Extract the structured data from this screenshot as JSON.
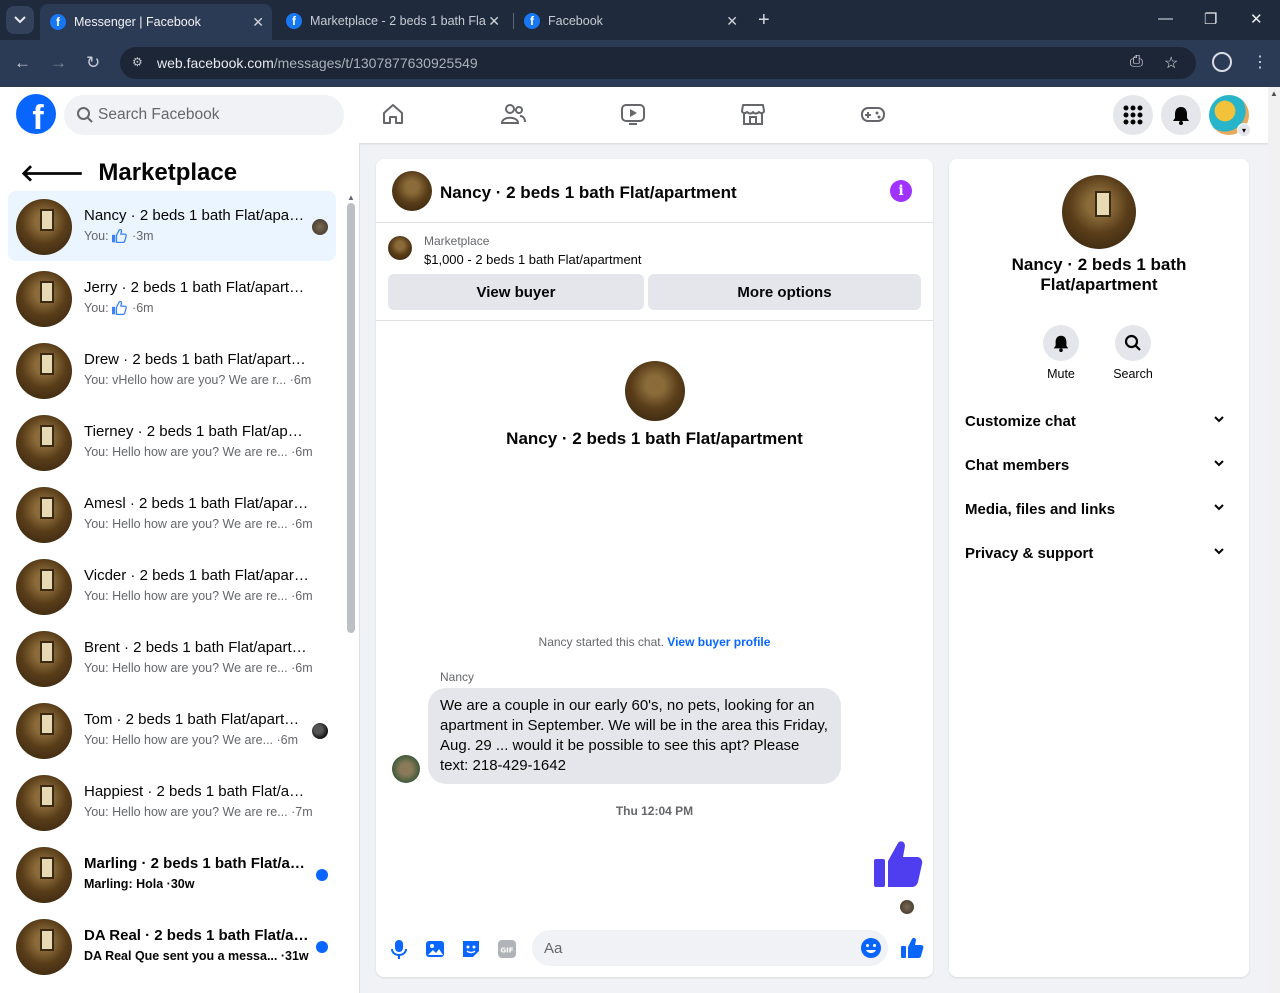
{
  "browser": {
    "tabs": [
      {
        "title": "Messenger | Facebook",
        "active": true
      },
      {
        "title": "Marketplace - 2 beds 1 bath Fla",
        "active": false
      },
      {
        "title": "Facebook",
        "active": false
      }
    ],
    "url_host": "web.facebook.com",
    "url_path": "/messages/t/1307877630925549"
  },
  "header": {
    "search_placeholder": "Search Facebook",
    "icons": [
      "home-icon",
      "friends-icon",
      "watch-icon",
      "marketplace-icon",
      "gaming-icon",
      "menu-grid-icon",
      "notifications-icon",
      "account-avatar"
    ]
  },
  "sidebar": {
    "title": "Marketplace",
    "conversations": [
      {
        "name": "Nancy · 2 beds 1 bath Flat/apartment",
        "you": "You:",
        "preview": "",
        "like": true,
        "time": "3m",
        "selected": true,
        "unread": false,
        "indicator": "seen"
      },
      {
        "name": "Jerry · 2 beds 1 bath Flat/apartment",
        "you": "You:",
        "preview": "",
        "like": true,
        "time": "6m",
        "selected": false,
        "unread": false,
        "indicator": "none"
      },
      {
        "name": "Drew · 2 beds 1 bath Flat/apartment",
        "you": "You:",
        "preview": "vHello how are you? We are r...",
        "like": false,
        "time": "6m",
        "selected": false,
        "unread": false,
        "indicator": "none"
      },
      {
        "name": "Tierney · 2 beds 1 bath Flat/apartment",
        "you": "You:",
        "preview": "Hello how are you? We are re...",
        "like": false,
        "time": "6m",
        "selected": false,
        "unread": false,
        "indicator": "none"
      },
      {
        "name": "Amesl · 2 beds 1 bath Flat/apartment",
        "you": "You:",
        "preview": "Hello how are you? We are re...",
        "like": false,
        "time": "6m",
        "selected": false,
        "unread": false,
        "indicator": "none"
      },
      {
        "name": "Vicder · 2 beds 1 bath Flat/apartment",
        "you": "You:",
        "preview": "Hello how are you? We are re...",
        "like": false,
        "time": "6m",
        "selected": false,
        "unread": false,
        "indicator": "none"
      },
      {
        "name": "Brent · 2 beds 1 bath Flat/apartment",
        "you": "You:",
        "preview": "Hello how are you? We are re...",
        "like": false,
        "time": "6m",
        "selected": false,
        "unread": false,
        "indicator": "none"
      },
      {
        "name": "Tom · 2 beds 1 bath Flat/apartment",
        "you": "You:",
        "preview": "Hello how are you? We are...",
        "like": false,
        "time": "6m",
        "selected": false,
        "unread": false,
        "indicator": "seen-dark"
      },
      {
        "name": "Happiest · 2 beds 1 bath Flat/apartment",
        "you": "You:",
        "preview": "Hello how are you? We are re...",
        "like": false,
        "time": "7m",
        "selected": false,
        "unread": false,
        "indicator": "none"
      },
      {
        "name": "Marling · 2 beds 1 bath Flat/apartment",
        "you": "Marling:",
        "preview": "Hola",
        "like": false,
        "time": "30w",
        "selected": false,
        "unread": true,
        "indicator": "dot"
      },
      {
        "name": "DA Real · 2 beds 1 bath Flat/apartment",
        "you": "DA Real",
        "preview": "Que sent you a messa...",
        "like": false,
        "time": "31w",
        "selected": false,
        "unread": true,
        "indicator": "dot"
      }
    ]
  },
  "chat": {
    "title": "Nancy · 2 beds 1 bath Flat/apartment",
    "listing_label": "Marketplace",
    "listing_price": "$1,000 - 2 beds 1 bath Flat/apartment",
    "view_buyer": "View buyer",
    "more_options": "More options",
    "intro_name": "Nancy · 2 beds 1 bath Flat/apartment",
    "started_text": "Nancy started this chat.",
    "view_buyer_profile": "View buyer profile",
    "sender": "Nancy",
    "message": "We are a couple in our early 60's, no pets, looking for an apartment in September.  We will be in the area this Friday, Aug. 29 ... would it be possible to see this apt?  Please text: 218-429-1642",
    "timestamp": "Thu 12:04 PM",
    "composer_placeholder": "Aa"
  },
  "right_panel": {
    "name": "Nancy · 2 beds 1 bath Flat/apartment",
    "mute": "Mute",
    "search": "Search",
    "sections": [
      "Customize chat",
      "Chat members",
      "Media, files and links",
      "Privacy & support"
    ]
  },
  "colors": {
    "accent": "#0866ff",
    "like": "#4f3df0",
    "info": "#a033ff"
  }
}
